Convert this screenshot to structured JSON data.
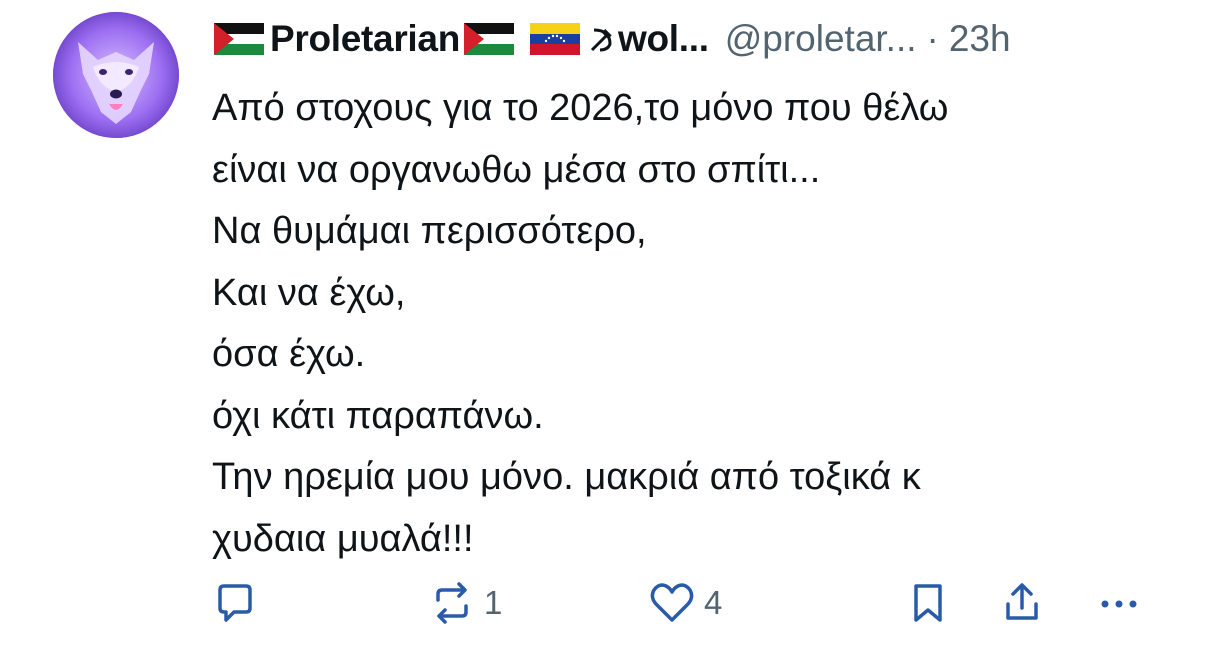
{
  "tweet": {
    "author": {
      "name_part1": "Proletarian",
      "name_part2": "wol...",
      "handle": "@proletar...",
      "avatar_icon": "purple-wolf-avatar",
      "flags": [
        "palestine-flag-icon",
        "palestine-flag-icon",
        "venezuela-flag-icon",
        "hammer-and-sickle-icon"
      ]
    },
    "separator": "·",
    "time": "23h",
    "lines": [
      "Από στοχους για το 2026,το μόνο που θέλω",
      "είναι να οργανωθω μέσα στο σπίτι...",
      "Να θυμάμαι περισσότερο,",
      "Και να έχω,",
      "όσα έχω.",
      "όχι κάτι παραπάνω.",
      "Την ηρεμία μου μόνο. μακριά από τοξικά κ",
      "χυδαια μυαλά!!!"
    ],
    "actions": {
      "reply_count": "",
      "repost_count": "1",
      "like_count": "4"
    },
    "colors": {
      "text": "#0f1419",
      "muted": "#536471",
      "icon": "#2a5ba8"
    }
  }
}
